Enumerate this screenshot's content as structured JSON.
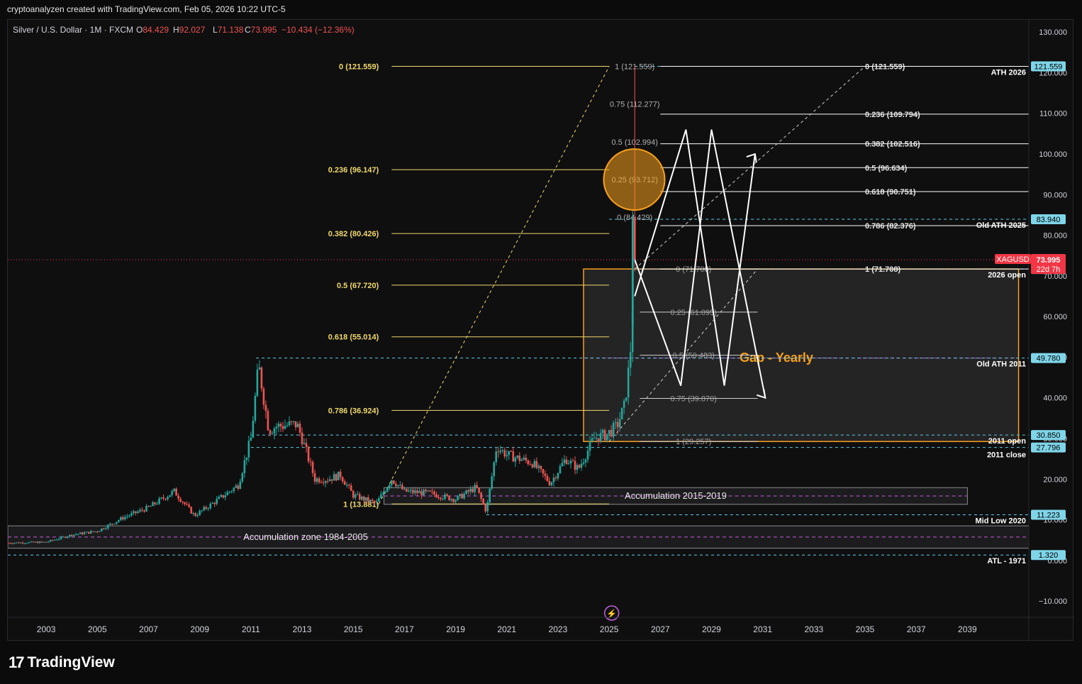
{
  "header": {
    "text": "cryptoanalyzen created with TradingView.com, Feb 05, 2026 10:22 UTC-5"
  },
  "legend": {
    "symbol": "Silver / U.S. Dollar · 1M · FXCM",
    "o_label": "O",
    "o_value": "84.429",
    "h_label": "H",
    "h_value": "92.027",
    "l_label": "L",
    "l_value": "71.138",
    "c_label": "C",
    "c_value": "73.995",
    "change": "−10.434 (−12.36%)"
  },
  "footer": {
    "logo_text": "TradingView"
  },
  "colors": {
    "background": "#0f0f10",
    "up": "#26a69a",
    "down": "#ef5350",
    "fib_left": "#f0d96b",
    "fib_right": "#ffffff",
    "cyan_line": "#5fd0e6",
    "orange": "#f7a01b",
    "price_red": "#f23645",
    "magenta": "#c45bd6"
  },
  "chart_data": {
    "type": "candlestick",
    "title": "",
    "symbol": "XAGUSD",
    "interval": "1M",
    "y_ticks": [
      "130.000",
      "120.000",
      "110.000",
      "100.000",
      "90.000",
      "80.000",
      "70.000",
      "60.000",
      "50.000",
      "40.000",
      "30.000",
      "20.000",
      "10.000",
      "0.000",
      "−10.000"
    ],
    "ylim": [
      -14,
      133
    ],
    "x_ticks": [
      "2003",
      "2005",
      "2007",
      "2009",
      "2011",
      "2013",
      "2015",
      "2017",
      "2019",
      "2021",
      "2023",
      "2025",
      "2027",
      "2029",
      "2031",
      "2033",
      "2035",
      "2037",
      "2039"
    ],
    "xlim": [
      2001.5,
      2041.4
    ],
    "series": [
      {
        "name": "XAGUSD",
        "anchors": [
          [
            2001.5,
            4.3
          ],
          [
            2003.0,
            4.5
          ],
          [
            2004.0,
            6.3
          ],
          [
            2005.0,
            7.2
          ],
          [
            2006.0,
            10.5
          ],
          [
            2007.0,
            13.0
          ],
          [
            2008.0,
            17.0
          ],
          [
            2008.8,
            11.0
          ],
          [
            2009.5,
            14.0
          ],
          [
            2010.5,
            18.5
          ],
          [
            2011.0,
            30.0
          ],
          [
            2011.3,
            48.0
          ],
          [
            2011.7,
            32.0
          ],
          [
            2012.0,
            33.0
          ],
          [
            2012.8,
            33.5
          ],
          [
            2013.0,
            30.0
          ],
          [
            2013.5,
            20.0
          ],
          [
            2014.0,
            20.0
          ],
          [
            2014.5,
            21.0
          ],
          [
            2015.0,
            16.0
          ],
          [
            2015.9,
            14.0
          ],
          [
            2016.5,
            20.0
          ],
          [
            2017.0,
            17.0
          ],
          [
            2018.0,
            16.5
          ],
          [
            2019.0,
            15.0
          ],
          [
            2019.8,
            18.0
          ],
          [
            2020.2,
            12.0
          ],
          [
            2020.6,
            28.0
          ],
          [
            2021.0,
            26.0
          ],
          [
            2022.0,
            24.0
          ],
          [
            2022.7,
            19.0
          ],
          [
            2023.3,
            25.0
          ],
          [
            2023.8,
            22.5
          ],
          [
            2024.4,
            30.0
          ],
          [
            2024.9,
            31.0
          ],
          [
            2025.3,
            33.0
          ],
          [
            2025.6,
            38.0
          ],
          [
            2025.8,
            49.0
          ],
          [
            2025.9,
            58.0
          ],
          [
            2026.0,
            84.4
          ]
        ]
      }
    ],
    "last_candle": {
      "open": 84.429,
      "high": 121.559,
      "low": 71.138,
      "close": 73.995
    },
    "fib_left": {
      "levels": [
        {
          "label": "0 (121.559)",
          "value": 121.559
        },
        {
          "label": "0.236 (96.147)",
          "value": 96.147
        },
        {
          "label": "0.382 (80.426)",
          "value": 80.426
        },
        {
          "label": "0.5 (67.720)",
          "value": 67.72
        },
        {
          "label": "0.618 (55.014)",
          "value": 55.014
        },
        {
          "label": "0.786 (36.924)",
          "value": 36.924
        },
        {
          "label": "1 (13.881)",
          "value": 13.881
        }
      ]
    },
    "fib_center": {
      "levels": [
        {
          "label": "1 (121.559)",
          "value": 121.559
        },
        {
          "label": "0.75 (112.277)",
          "value": 112.277
        },
        {
          "label": "0.5 (102.994)",
          "value": 102.994
        },
        {
          "label": "0.25 (93.712)",
          "value": 93.712
        },
        {
          "label": "0 (84.429)",
          "value": 84.429
        }
      ]
    },
    "fib_lower": {
      "levels": [
        {
          "label": "0 (71.708)",
          "value": 71.708
        },
        {
          "label": "0.25 (61.095)",
          "value": 61.095
        },
        {
          "label": "0.5 (50.483)",
          "value": 50.483
        },
        {
          "label": "0.75 (39.870)",
          "value": 39.87
        },
        {
          "label": "1 (29.257)",
          "value": 29.257
        }
      ]
    },
    "fib_right": {
      "levels": [
        {
          "label": "0 (121.559)",
          "value": 121.559
        },
        {
          "label": "0.236 (109.794)",
          "value": 109.794
        },
        {
          "label": "0.382 (102.516)",
          "value": 102.516
        },
        {
          "label": "0.5 (96.634)",
          "value": 96.634
        },
        {
          "label": "0.618 (90.751)",
          "value": 90.751
        },
        {
          "label": "0.786 (82.376)",
          "value": 82.376
        },
        {
          "label": "1 (71.708)",
          "value": 71.708
        }
      ]
    },
    "horizontal_levels": [
      {
        "label": "ATH 2026",
        "value": 121.559,
        "badge": "121.559"
      },
      {
        "label": "Old ATH 2025",
        "value": 83.94,
        "badge": "83.940"
      },
      {
        "label": "2026 open",
        "value": 71.708,
        "badge": "71.708"
      },
      {
        "label": "Old ATH 2011",
        "value": 49.78,
        "badge": "49.780"
      },
      {
        "label": "2011 open",
        "value": 30.85,
        "badge": "30.850"
      },
      {
        "label": "2011 close",
        "value": 27.796,
        "badge": "27.796"
      },
      {
        "label": "Mid Low 2020",
        "value": 11.223,
        "badge": "11.223"
      },
      {
        "label": "ATL - 1971",
        "value": 1.32,
        "badge": "1.320"
      }
    ],
    "price_tag": {
      "symbol": "XAGUSD",
      "value": "73.995",
      "countdown": "22d 7h"
    },
    "zones": [
      {
        "label": "Accumulation zone 1984-2005",
        "from": 2001.5,
        "to": 2041.4,
        "low": 3,
        "high": 8.5
      },
      {
        "label": "Accumulation 2015-2019",
        "from": 2016.2,
        "to": 2039.0,
        "low": 13.8,
        "high": 17.9
      }
    ],
    "gap_box": {
      "label": "Gap - Yearly",
      "from": 2024.0,
      "to": 2041.0,
      "low": 29.257,
      "high": 71.708
    },
    "legend_position": "top-left",
    "grid": false
  }
}
